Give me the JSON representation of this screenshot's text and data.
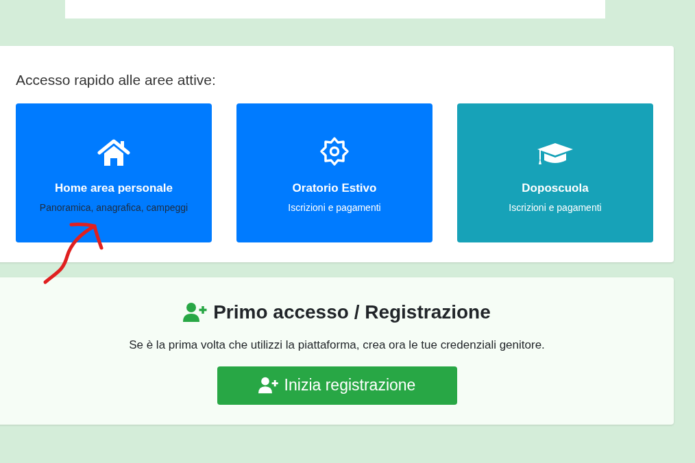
{
  "quick_access": {
    "heading": "Accesso rapido alle aree attive:",
    "tiles": [
      {
        "kind": "home",
        "title": "Home area personale",
        "subtitle": "Panoramica, anagrafica, campeggi",
        "color": "#007bff",
        "muted": true
      },
      {
        "kind": "gear",
        "title": "Oratorio Estivo",
        "subtitle": "Iscrizioni e pagamenti",
        "color": "#007bff",
        "muted": false
      },
      {
        "kind": "cap",
        "title": "Doposcuola",
        "subtitle": "Iscrizioni e pagamenti",
        "color": "#17a2b8",
        "muted": false
      }
    ]
  },
  "registration": {
    "title": "Primo accesso / Registrazione",
    "text": "Se è la prima volta che utilizzi la piattaforma, crea ora le tue credenziali genitore.",
    "button": "Inizia registrazione"
  }
}
